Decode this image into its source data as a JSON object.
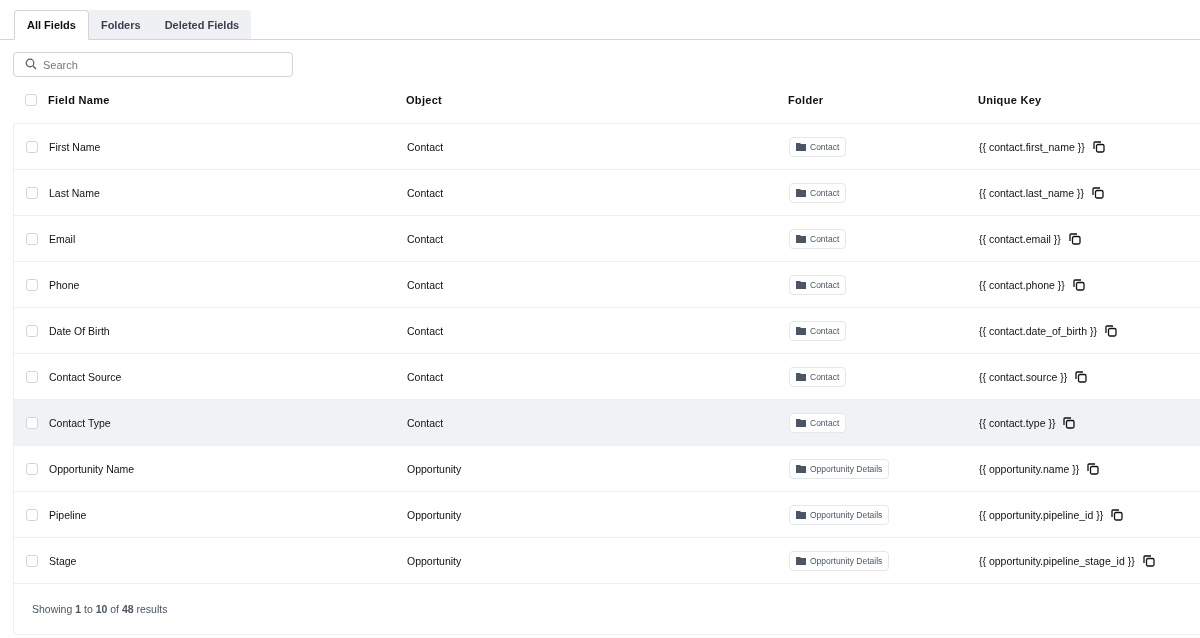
{
  "tabs": [
    {
      "label": "All Fields",
      "selected": true
    },
    {
      "label": "Folders",
      "selected": false
    },
    {
      "label": "Deleted Fields",
      "selected": false
    }
  ],
  "search": {
    "placeholder": "Search"
  },
  "table": {
    "header_checked": false,
    "columns": [
      "Field Name",
      "Object",
      "Folder",
      "Unique Key"
    ],
    "rows": [
      {
        "checked": false,
        "highlighted": false,
        "field_name": "First Name",
        "object": "Contact",
        "folder": "Contact",
        "unique_key": "{{ contact.first_name }}"
      },
      {
        "checked": false,
        "highlighted": false,
        "field_name": "Last Name",
        "object": "Contact",
        "folder": "Contact",
        "unique_key": "{{ contact.last_name }}"
      },
      {
        "checked": false,
        "highlighted": false,
        "field_name": "Email",
        "object": "Contact",
        "folder": "Contact",
        "unique_key": "{{ contact.email }}"
      },
      {
        "checked": false,
        "highlighted": false,
        "field_name": "Phone",
        "object": "Contact",
        "folder": "Contact",
        "unique_key": "{{ contact.phone }}"
      },
      {
        "checked": false,
        "highlighted": false,
        "field_name": "Date Of Birth",
        "object": "Contact",
        "folder": "Contact",
        "unique_key": "{{ contact.date_of_birth }}"
      },
      {
        "checked": false,
        "highlighted": false,
        "field_name": "Contact Source",
        "object": "Contact",
        "folder": "Contact",
        "unique_key": "{{ contact.source }}"
      },
      {
        "checked": false,
        "highlighted": true,
        "field_name": "Contact Type",
        "object": "Contact",
        "folder": "Contact",
        "unique_key": "{{ contact.type }}"
      },
      {
        "checked": false,
        "highlighted": false,
        "field_name": "Opportunity Name",
        "object": "Opportunity",
        "folder": "Opportunity Details",
        "unique_key": "{{ opportunity.name }}"
      },
      {
        "checked": false,
        "highlighted": false,
        "field_name": "Pipeline",
        "object": "Opportunity",
        "folder": "Opportunity Details",
        "unique_key": "{{ opportunity.pipeline_id }}"
      },
      {
        "checked": false,
        "highlighted": false,
        "field_name": "Stage",
        "object": "Opportunity",
        "folder": "Opportunity Details",
        "unique_key": "{{ opportunity.pipeline_stage_id }}"
      }
    ]
  },
  "footer": {
    "summary": "Showing **1** to **10** of **48** results"
  }
}
